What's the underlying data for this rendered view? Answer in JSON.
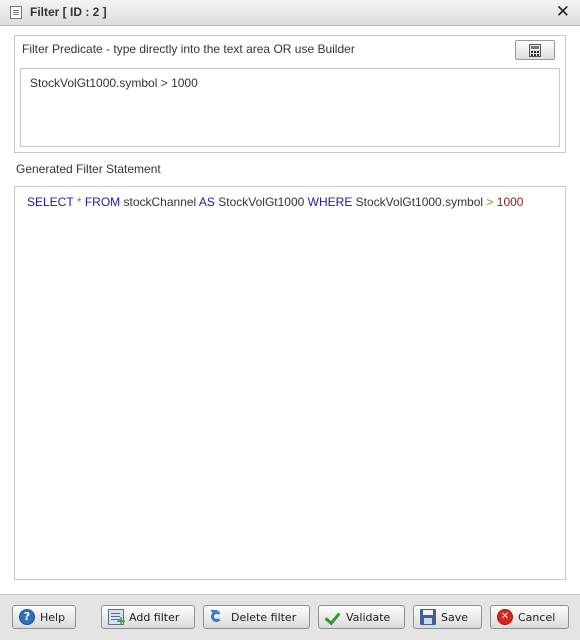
{
  "window": {
    "title": "Filter [ ID : 2 ]",
    "close_glyph": "✕"
  },
  "predicate": {
    "label": "Filter Predicate - type directly into the text area OR use Builder",
    "builder_icon": "calculator-icon",
    "value": "StockVolGt1000.symbol > 1000"
  },
  "generated": {
    "label": "Generated Filter Statement",
    "tokens": {
      "select": "SELECT",
      "star": "*",
      "from": "FROM",
      "channel": "stockChannel",
      "as": "AS",
      "alias": "StockVolGt1000",
      "where": "WHERE",
      "field": "StockVolGt1000.symbol",
      "op": ">",
      "value": "1000"
    },
    "colors": {
      "keyword": "#1a1ab0",
      "operator": "#b57500",
      "number": "#8b1a1a"
    }
  },
  "footer": {
    "help": "Help",
    "add_filter": "Add filter",
    "delete_filter": "Delete filter",
    "validate": "Validate",
    "save": "Save",
    "cancel": "Cancel",
    "help_glyph": "?",
    "cancel_glyph": "✕"
  }
}
